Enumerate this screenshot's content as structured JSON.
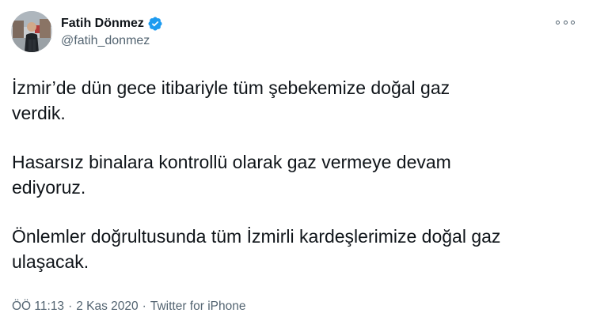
{
  "author": {
    "display_name": "Fatih Dönmez",
    "handle": "@fatih_donmez",
    "verified": true,
    "verified_color": "#1d9bf0"
  },
  "icons": {
    "avatar": "profile-photo",
    "verified": "verified-badge-icon",
    "more": "more-options-icon"
  },
  "tweet": {
    "paragraphs": [
      "İzmir’de dün gece itibariyle tüm şebekemize doğal gaz\nverdik.",
      "Hasarsız binalara kontrollü olarak gaz vermeye devam\nediyoruz.",
      "Önlemler doğrultusunda tüm İzmirli kardeşlerimize doğal gaz\nulaşacak."
    ]
  },
  "meta": {
    "time": "ÖÖ 11:13",
    "separator": "·",
    "date": "2 Kas 2020",
    "source": "Twitter for iPhone"
  }
}
